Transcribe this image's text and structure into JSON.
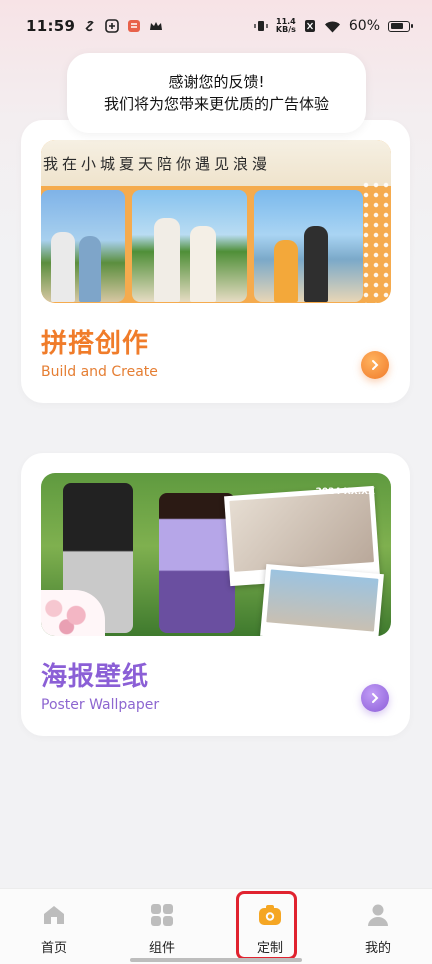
{
  "status_bar": {
    "time": "11:59",
    "net_speed_value": "11.4",
    "net_speed_unit": "KB/s",
    "battery_pct": "60%"
  },
  "toast": {
    "line1": "感谢您的反馈!",
    "line2": "我们将为您带来更优质的广告体验"
  },
  "cards": [
    {
      "banner_caption": "我在小城夏天陪你遇见浪漫",
      "title": "拼搭创作",
      "subtitle": "Build and Create",
      "accent": "#f07c2a"
    },
    {
      "banner_stamp": "2024 XX.XX",
      "title": "海报壁纸",
      "subtitle": "Poster Wallpaper",
      "accent": "#8b5fd6"
    }
  ],
  "bottom_nav": {
    "items": [
      {
        "label": "首页",
        "icon": "home-icon"
      },
      {
        "label": "组件",
        "icon": "grid-icon"
      },
      {
        "label": "定制",
        "icon": "camera-icon",
        "active": true
      },
      {
        "label": "我的",
        "icon": "person-icon"
      }
    ],
    "active_color": "#f5a623",
    "highlight_color": "#e0232f"
  }
}
